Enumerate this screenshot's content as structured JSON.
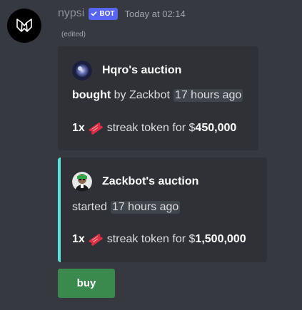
{
  "message": {
    "username": "nypsi",
    "bot_badge": "BOT",
    "timestamp": "Today at 02:14",
    "edited": "(edited)"
  },
  "embeds": [
    {
      "author": "Hqro's auction",
      "status_word": "bought",
      "status_rest": "by Zackbot",
      "time_ago": "17 hours ago",
      "quantity": "1x",
      "item": "streak token for $",
      "price": "450,000",
      "accent_color": "#2f3136"
    },
    {
      "author": "Zackbot's auction",
      "status_word": "started",
      "time_ago": "17 hours ago",
      "quantity": "1x",
      "item": "streak token for $",
      "price": "1,500,000",
      "accent_color": "#58e5e0"
    }
  ],
  "buy_button": {
    "label": "buy",
    "color": "#3b8a4d"
  },
  "icons": {
    "avatar": "nypsi-logo-icon",
    "badge_check": "checkmark-icon",
    "ticket": "ticket-icon"
  }
}
